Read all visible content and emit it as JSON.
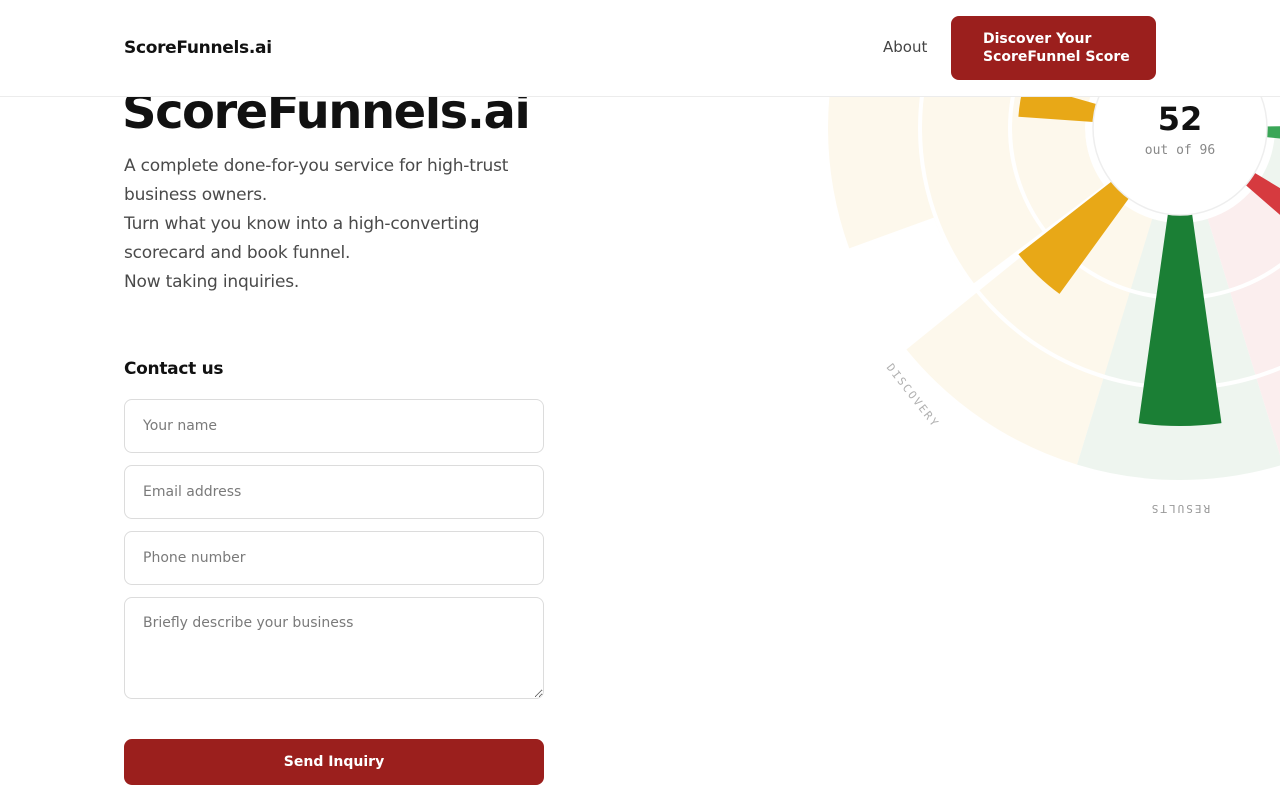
{
  "header": {
    "brand": "ScoreFunnels.ai",
    "nav_about": "About",
    "cta_line1": "Discover Your",
    "cta_line2": "ScoreFunnel Score"
  },
  "hero": {
    "title": "ScoreFunnels.ai",
    "lines": [
      "A complete done-for-you service for high-trust",
      "business owners.",
      "Turn what you know into a high-converting",
      "scorecard and book funnel.",
      "Now taking inquiries."
    ]
  },
  "contact": {
    "heading": "Contact us",
    "name_placeholder": "Your name",
    "email_placeholder": "Email address",
    "phone_placeholder": "Phone number",
    "business_placeholder": "Briefly describe your business",
    "submit_label": "Send Inquiry"
  },
  "scorecard": {
    "score": "52",
    "out_of": "out of 96",
    "labels": {
      "discovery": "DISCOVERY",
      "results": "RESULTS"
    },
    "colors": {
      "amber": "#e8a817",
      "green": "#1b7f35",
      "red": "#d63a3f",
      "amber_bg": "#fdf8ec",
      "green_bg": "#eef5ef",
      "red_bg": "#fbeeee",
      "brand": "#9b1f1d"
    }
  }
}
